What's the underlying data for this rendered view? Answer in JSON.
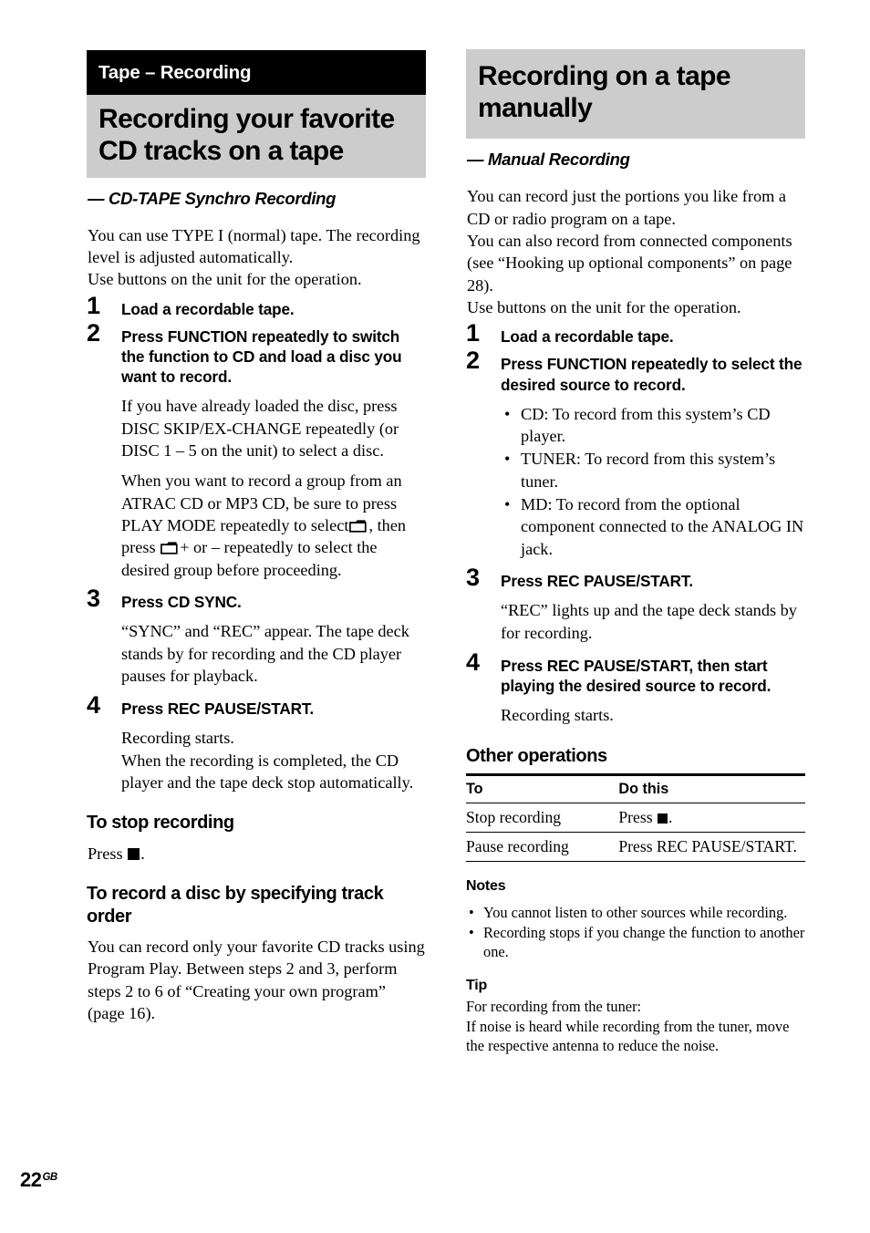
{
  "page": {
    "number": "22",
    "region_suffix": "GB"
  },
  "left_column": {
    "chapter_bar": "Tape – Recording",
    "title": "Recording your favorite CD tracks on a tape",
    "subtitle": "— CD-TAPE Synchro Recording",
    "intro": [
      "You can use TYPE I (normal) tape. The recording level is adjusted automatically.",
      "Use buttons on the unit for the operation."
    ],
    "steps": [
      {
        "num": "1",
        "title": "Load a recordable tape.",
        "body": []
      },
      {
        "num": "2",
        "title": "Press FUNCTION repeatedly to switch the function to CD and load a disc you want to record.",
        "body": [
          "If you have already loaded the disc, press DISC SKIP/EX-CHANGE repeatedly (or DISC 1 – 5 on the unit) to select a disc.",
          "When you want to record a group from an ATRAC CD or MP3 CD, be sure to press PLAY MODE repeatedly to select",
          ", then press",
          "+ or – repeatedly to select the desired group before proceeding."
        ]
      },
      {
        "num": "3",
        "title": "Press CD SYNC.",
        "body": [
          "“SYNC” and “REC” appear. The tape deck stands by for recording and the CD player pauses for playback."
        ]
      },
      {
        "num": "4",
        "title": "Press REC PAUSE/START.",
        "body": [
          "Recording starts.",
          "When the recording is completed, the CD player and the tape deck stop automatically."
        ]
      }
    ],
    "stop_section": {
      "heading": "To stop recording",
      "press_label": "Press",
      "press_suffix": "."
    },
    "track_order_section": {
      "heading": "To record a disc by specifying track order",
      "body": "You can record only your favorite CD tracks using Program Play. Between steps 2 and 3, perform steps 2 to 6 of “Creating your own program” (page 16)."
    }
  },
  "right_column": {
    "title": "Recording on a tape manually",
    "subtitle": "— Manual Recording",
    "intro": [
      "You can record just the portions you like from a CD or radio program on a tape.",
      "You can also record from connected components (see “Hooking up optional components” on page 28).",
      "Use buttons on the unit for the operation."
    ],
    "steps": [
      {
        "num": "1",
        "title": "Load a recordable tape.",
        "body": [],
        "bullets": []
      },
      {
        "num": "2",
        "title": "Press FUNCTION repeatedly to select the desired source to record.",
        "body": [],
        "bullets": [
          "CD: To record from this system’s CD player.",
          "TUNER: To record from this system’s tuner.",
          "MD: To record from the optional component connected to the ANALOG IN jack."
        ]
      },
      {
        "num": "3",
        "title": "Press REC PAUSE/START.",
        "body": [
          "“REC” lights up and the tape deck stands by for recording."
        ],
        "bullets": []
      },
      {
        "num": "4",
        "title": "Press REC PAUSE/START, then start playing the desired source to record.",
        "body": [
          "Recording starts."
        ],
        "bullets": []
      }
    ],
    "other_operations": {
      "heading": "Other operations",
      "columns": [
        "To",
        "Do this"
      ],
      "rows": [
        {
          "to": "Stop recording",
          "do_prefix": "Press",
          "do_suffix": ".",
          "has_stop_glyph": true
        },
        {
          "to": "Pause recording",
          "do_prefix": "Press REC PAUSE/START.",
          "do_suffix": "",
          "has_stop_glyph": false
        }
      ]
    },
    "notes": {
      "heading": "Notes",
      "items": [
        "You cannot listen to other sources while recording.",
        "Recording stops if you change the function to another one."
      ]
    },
    "tip": {
      "heading": "Tip",
      "lines": [
        "For recording from the tuner:",
        "If noise is heard while recording from the tuner, move the respective antenna to reduce the noise."
      ]
    }
  }
}
